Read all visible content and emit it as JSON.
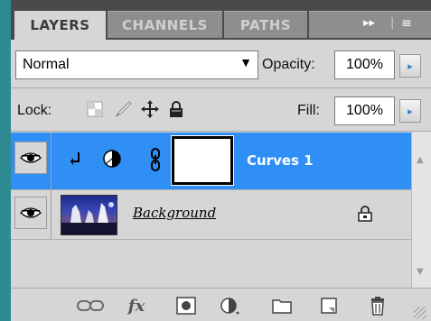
{
  "tabs": [
    {
      "label": "LAYERS",
      "active": true
    },
    {
      "label": "CHANNELS",
      "active": false
    },
    {
      "label": "PATHS",
      "active": false
    }
  ],
  "tab_controls": {
    "expand": "▸▸",
    "menu": "≡"
  },
  "blend_mode": {
    "value": "Normal",
    "arrow": "▼"
  },
  "opacity": {
    "label": "Opacity:",
    "value": "100%",
    "arrow": "▸"
  },
  "lock": {
    "label": "Lock:",
    "icons": [
      "transparency-lock-icon",
      "brush-lock-icon",
      "move-lock-icon",
      "padlock-icon"
    ]
  },
  "fill": {
    "label": "Fill:",
    "value": "100%",
    "arrow": "▸"
  },
  "layers": [
    {
      "name": "Curves 1",
      "type": "adjustment",
      "selected": true,
      "visible": true
    },
    {
      "name": "Background",
      "type": "image",
      "selected": false,
      "visible": true,
      "locked": true
    }
  ],
  "toolbar_icons": [
    "link-layers-icon",
    "layer-style-fx-icon",
    "add-mask-icon",
    "adjustment-layer-icon",
    "new-group-folder-icon",
    "new-layer-icon",
    "trash-icon"
  ],
  "toolbar_fx": "fx",
  "colors": {
    "selected_row": "#2f8ff5",
    "panel_bg": "#d6d6d6",
    "tabbar_bg": "#4a4a4a",
    "step_arrow": "#3a7bd5"
  }
}
